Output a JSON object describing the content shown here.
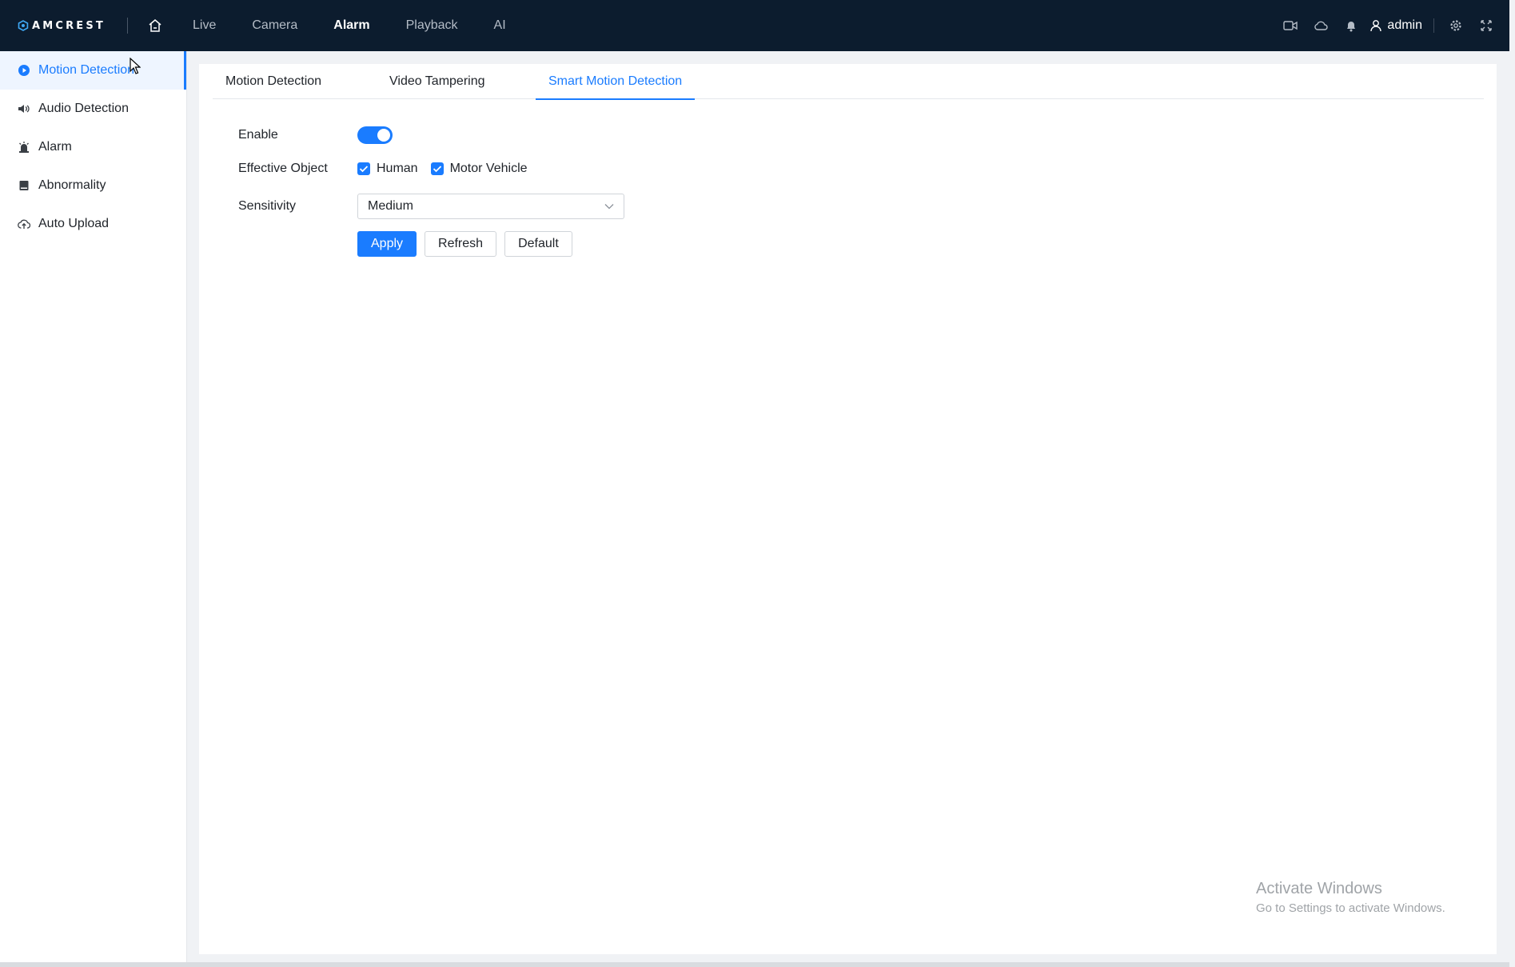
{
  "brand": {
    "logo_text": "AMCREST"
  },
  "nav": {
    "items": [
      {
        "label": "Live",
        "active": false
      },
      {
        "label": "Camera",
        "active": false
      },
      {
        "label": "Alarm",
        "active": true
      },
      {
        "label": "Playback",
        "active": false
      },
      {
        "label": "AI",
        "active": false
      }
    ]
  },
  "header": {
    "user": "admin",
    "icons": [
      "video-camera-icon",
      "cloud-icon",
      "bell-icon",
      "user-icon",
      "gear-icon",
      "fullscreen-icon"
    ]
  },
  "sidebar": {
    "items": [
      {
        "label": "Motion Detection",
        "icon": "play-circle-icon",
        "active": true
      },
      {
        "label": "Audio Detection",
        "icon": "speaker-icon",
        "active": false
      },
      {
        "label": "Alarm",
        "icon": "alarm-icon",
        "active": false
      },
      {
        "label": "Abnormality",
        "icon": "storage-icon",
        "active": false
      },
      {
        "label": "Auto Upload",
        "icon": "cloud-upload-icon",
        "active": false
      }
    ]
  },
  "tabs": [
    {
      "label": "Motion Detection",
      "active": false
    },
    {
      "label": "Video Tampering",
      "active": false
    },
    {
      "label": "Smart Motion Detection",
      "active": true
    }
  ],
  "form": {
    "enable_label": "Enable",
    "enable_value": true,
    "object_label": "Effective Object",
    "objects": [
      {
        "label": "Human",
        "checked": true
      },
      {
        "label": "Motor Vehicle",
        "checked": true
      }
    ],
    "sensitivity_label": "Sensitivity",
    "sensitivity_value": "Medium"
  },
  "buttons": {
    "apply": "Apply",
    "refresh": "Refresh",
    "default": "Default"
  },
  "watermark": {
    "title": "Activate Windows",
    "subtitle": "Go to Settings to activate Windows."
  },
  "colors": {
    "accent": "#1a7cff",
    "topbar": "#0c1c2e"
  }
}
